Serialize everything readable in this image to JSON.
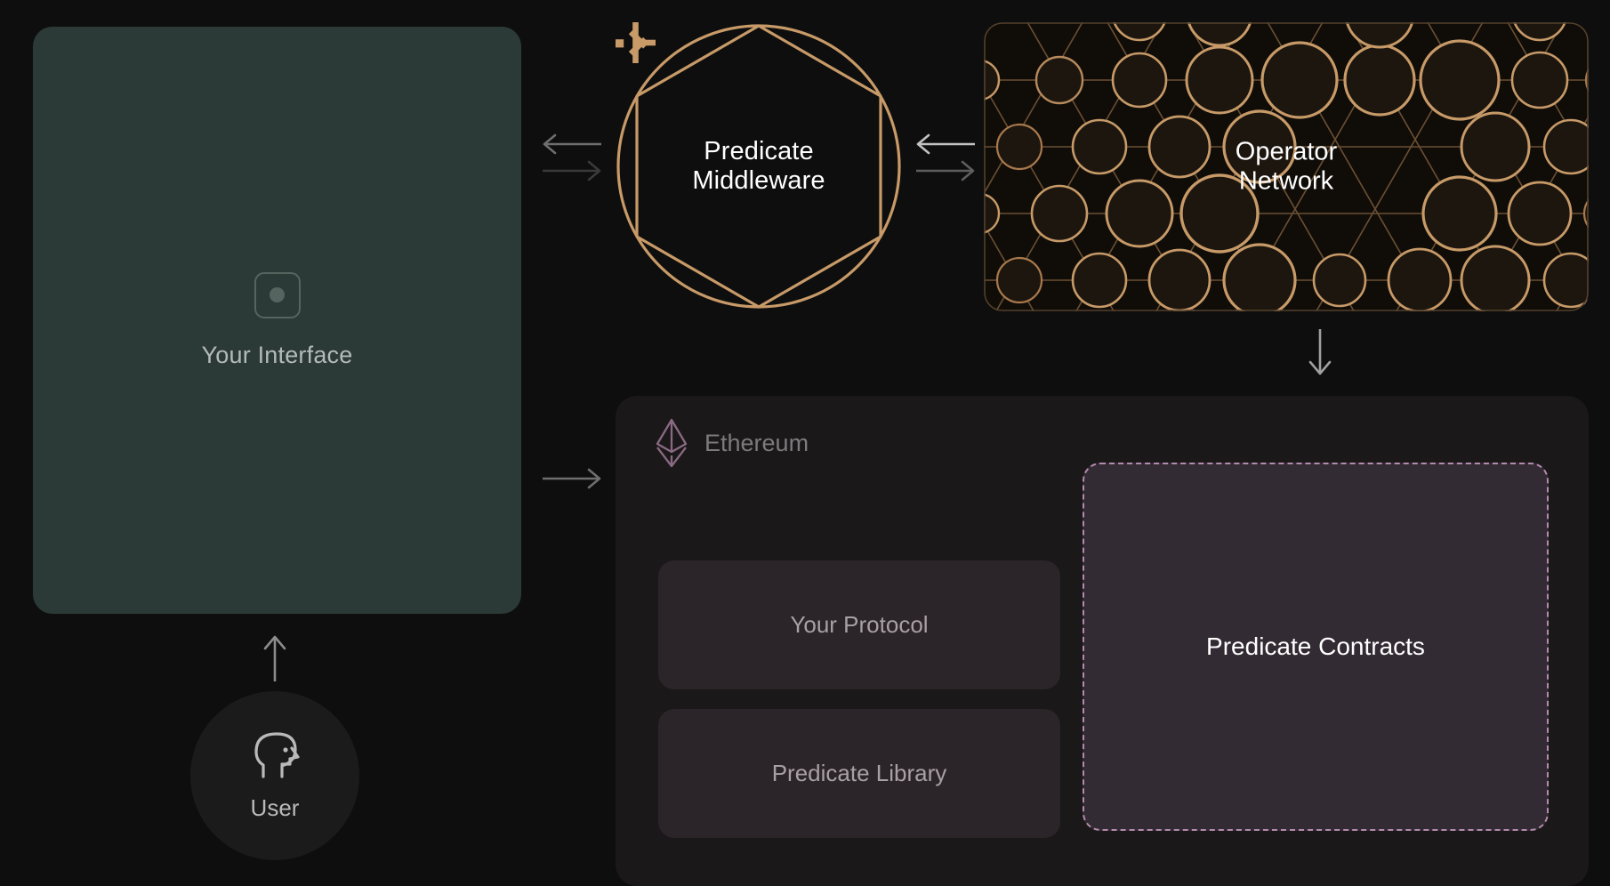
{
  "diagram": {
    "background": "#0e0e0e",
    "interface": {
      "label": "Your Interface",
      "icon": "square-dot-icon",
      "bg_color": "#2b3a37"
    },
    "user": {
      "label": "User",
      "icon": "user-head-profile-icon"
    },
    "middleware": {
      "label": "Predicate\nMiddleware",
      "logo": "predicate-asterisk-logo",
      "accent_color": "#c79a68"
    },
    "operator": {
      "label": "Operator\nNetwork",
      "accent_color": "#c79a68",
      "pattern": "triangular-lattice-nodes"
    },
    "ethereum": {
      "name": "Ethereum",
      "logo": "ethereum-diamond-icon",
      "logo_color": "#8a6a82",
      "cards": [
        {
          "label": "Your Protocol",
          "name": "your-protocol"
        },
        {
          "label": "Predicate Library",
          "name": "predicate-library"
        }
      ],
      "contracts": {
        "label": "Predicate Contracts",
        "border_color": "#b48bb0",
        "bg_color": "#332b33",
        "border_style": "dashed"
      }
    },
    "connectors": [
      {
        "name": "interface-middleware",
        "type": "bidirectional-horizontal"
      },
      {
        "name": "middleware-operator",
        "type": "bidirectional-horizontal"
      },
      {
        "name": "operator-ethereum",
        "type": "arrow-down"
      },
      {
        "name": "interface-ethereum",
        "type": "arrow-right"
      },
      {
        "name": "user-interface",
        "type": "arrow-up"
      }
    ]
  }
}
